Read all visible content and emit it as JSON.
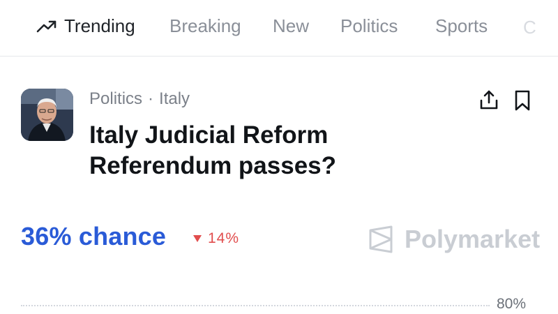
{
  "nav": {
    "items": [
      {
        "label": "Trending",
        "icon": "trending-up-icon",
        "active": true
      },
      {
        "label": "Breaking"
      },
      {
        "label": "New"
      },
      {
        "label": "Politics"
      },
      {
        "label": "Sports"
      },
      {
        "label": "C"
      }
    ]
  },
  "market": {
    "category": "Politics",
    "separator": "·",
    "subcategory": "Italy",
    "title_line1": "Italy Judicial Reform",
    "title_line2": "Referendum passes?",
    "chance": "36% chance",
    "change": "14%",
    "change_direction": "down",
    "change_color": "#e14d4d",
    "accent_color": "#2a5bd7"
  },
  "brand": {
    "name": "Polymarket"
  },
  "chart": {
    "axis_label": "80%"
  }
}
